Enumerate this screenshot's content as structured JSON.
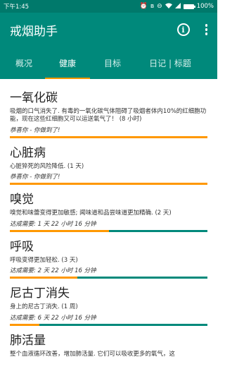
{
  "status_bar": {
    "time": "下午1:45",
    "battery_text": "100%",
    "icons": [
      "alarm-icon",
      "bluetooth-icon",
      "dnd-icon",
      "wifi-icon",
      "sim-icon",
      "battery-charging-icon"
    ]
  },
  "app_bar": {
    "title": "戒烟助手",
    "actions": [
      "info-icon",
      "more-vert-icon"
    ]
  },
  "tabs": [
    {
      "label": "概况",
      "active": false
    },
    {
      "label": "健康",
      "active": true
    },
    {
      "label": "目标",
      "active": false
    },
    {
      "label": "日记 | 标题",
      "active": false
    }
  ],
  "colors": {
    "primary": "#00897b",
    "primary_dark": "#00796b",
    "accent": "#ff9800"
  },
  "cards": [
    {
      "title": "一氧化碳",
      "description": "吸烟的口气消失了. 有毒的一氧化碳气体阻碍了吸烟者体内10%的红细胞功能，现在这些红细胞又可以运送氧气了！ (8 小时)",
      "status": "恭喜你 - 你做到了!",
      "progress": 1.0
    },
    {
      "title": "心脏病",
      "description": "心脏猝死的风险降低. (1 天)",
      "status": "恭喜你 - 你做到了!",
      "progress": 1.0
    },
    {
      "title": "嗅觉",
      "description": "嗅觉和味蕾变得更加敏感; 闻味道和品尝味道更加精确. (2 天)",
      "status": "达成需要: 1 天 22 小时 16 分钟",
      "progress": 0.5
    },
    {
      "title": "呼吸",
      "description": "呼吸变得更加轻松. (3 天)",
      "status": "达成需要: 2 天 22 小时 16 分钟",
      "progress": 0.34
    },
    {
      "title": "尼古丁消失",
      "description": "身上的尼古丁消失. (1 周)",
      "status": "达成需要: 6 天 22 小时 16 分钟",
      "progress": 0.15
    },
    {
      "title": "肺活量",
      "description": "整个血液循环改善，增加肺活量. 它们可以吸收更多的氧气，这",
      "status": "",
      "progress": null
    }
  ]
}
